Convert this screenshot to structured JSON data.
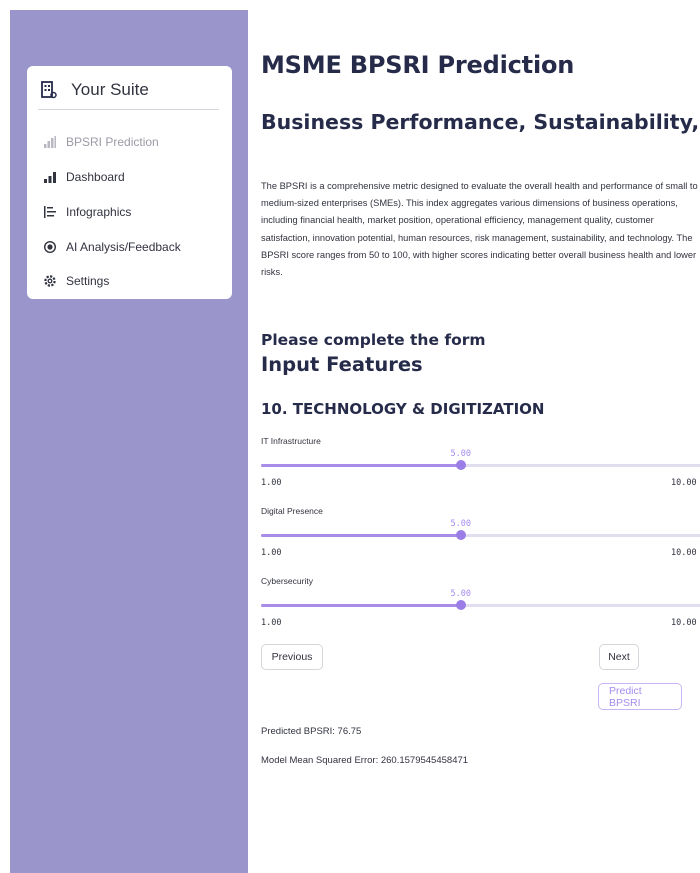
{
  "sidebar": {
    "title": "Your Suite",
    "items": [
      {
        "label": "BPSRI Prediction",
        "icon": "bar-chart-icon",
        "active": true
      },
      {
        "label": "Dashboard",
        "icon": "bar-chart-icon",
        "active": false
      },
      {
        "label": "Infographics",
        "icon": "list-icon",
        "active": false
      },
      {
        "label": "AI Analysis/Feedback",
        "icon": "ai-icon",
        "active": false
      },
      {
        "label": "Settings",
        "icon": "gear-icon",
        "active": false
      }
    ]
  },
  "main": {
    "title": "MSME BPSRI Prediction",
    "subtitle": "Business Performance, Sustainability, and Risk Index (BPSRI):",
    "description": "The BPSRI is a comprehensive metric designed to evaluate the overall health and performance of small to medium-sized enterprises (SMEs). This index aggregates various dimensions of business operations, including financial health, market position, operational efficiency, management quality, customer satisfaction, innovation potential, human resources, risk management, sustainability, and technology. The BPSRI score ranges from 50 to 100, with higher scores indicating better overall business health and lower risks.",
    "form_prompt": "Please complete the form",
    "input_features_heading": "Input Features",
    "section_heading": "10. TECHNOLOGY & DIGITIZATION",
    "sliders": [
      {
        "label": "IT Infrastructure",
        "value": "5.00",
        "min": "1.00",
        "max": "10.00",
        "fraction": 0.444
      },
      {
        "label": "Digital Presence",
        "value": "5.00",
        "min": "1.00",
        "max": "10.00",
        "fraction": 0.444
      },
      {
        "label": "Cybersecurity",
        "value": "5.00",
        "min": "1.00",
        "max": "10.00",
        "fraction": 0.444
      }
    ],
    "buttons": {
      "previous": "Previous",
      "next": "Next",
      "predict": "Predict BPSRI"
    },
    "results": {
      "predicted": "Predicted BPSRI: 76.75",
      "mse": "Model Mean Squared Error: 260.1579545458471"
    }
  },
  "colors": {
    "sidebar_bg": "#9a96cc",
    "accent": "#a58cf0",
    "heading": "#262b4a"
  }
}
